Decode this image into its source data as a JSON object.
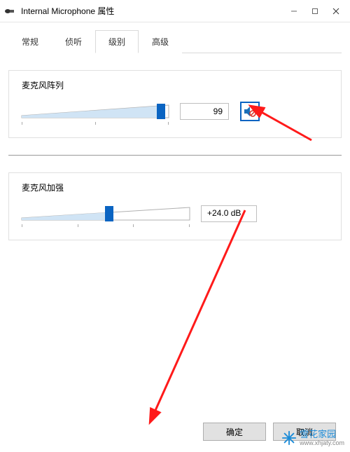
{
  "window": {
    "title": "Internal Microphone 属性"
  },
  "tabs": {
    "items": [
      "常规",
      "侦听",
      "级别",
      "高级"
    ],
    "active_index": 2
  },
  "mic_array": {
    "label": "麦克风阵列",
    "value": "99",
    "slider_percent": 95
  },
  "mic_boost": {
    "label": "麦克风加强",
    "value": "+24.0 dB",
    "slider_percent": 52
  },
  "buttons": {
    "ok": "确定",
    "cancel": "取消"
  },
  "watermark": {
    "name": "雪花家园",
    "url": "www.xhjaty.com"
  }
}
